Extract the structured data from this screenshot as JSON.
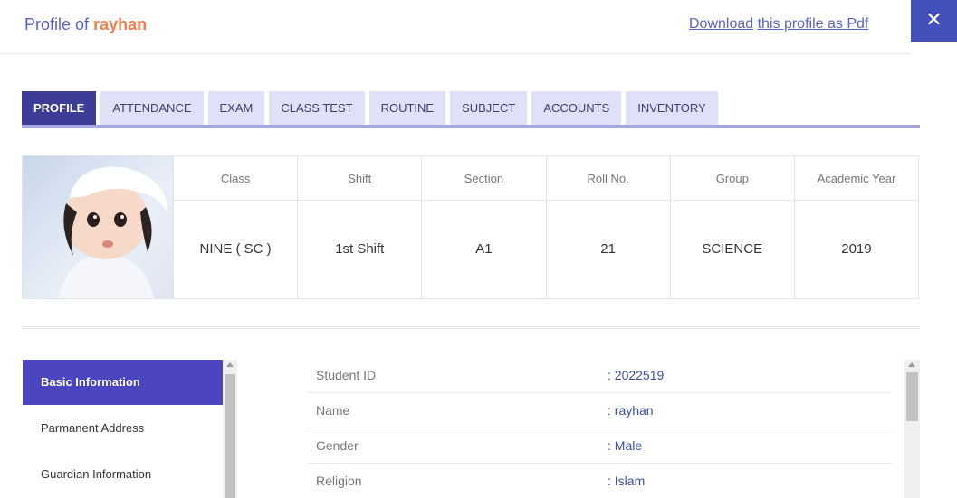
{
  "header": {
    "title_prefix": "Profile of",
    "user_name": "rayhan",
    "download_label": "Download",
    "download_rest": "this profile as Pdf",
    "close_glyph": "✕"
  },
  "tabs": [
    {
      "label": "PROFILE",
      "active": true
    },
    {
      "label": "ATTENDANCE"
    },
    {
      "label": "EXAM"
    },
    {
      "label": "CLASS TEST"
    },
    {
      "label": "ROUTINE"
    },
    {
      "label": "SUBJECT"
    },
    {
      "label": "ACCOUNTS"
    },
    {
      "label": "INVENTORY"
    }
  ],
  "summary": {
    "columns": [
      {
        "head": "Class",
        "value": "NINE ( SC )"
      },
      {
        "head": "Shift",
        "value": "1st Shift"
      },
      {
        "head": "Section",
        "value": "A1"
      },
      {
        "head": "Roll No.",
        "value": "21"
      },
      {
        "head": "Group",
        "value": "SCIENCE"
      },
      {
        "head": "Academic Year",
        "value": "2019"
      }
    ]
  },
  "side_menu": [
    {
      "label": "Basic Information",
      "active": true
    },
    {
      "label": "Parmanent Address"
    },
    {
      "label": "Guardian Information"
    }
  ],
  "info": [
    {
      "key": "Student ID",
      "value": ": 2022519"
    },
    {
      "key": "Name",
      "value": ": rayhan"
    },
    {
      "key": "Gender",
      "value": ": Male"
    },
    {
      "key": "Religion",
      "value": ": Islam"
    }
  ],
  "colors": {
    "accent": "#4350b9",
    "tab_active": "#3d3c96",
    "tab_inactive": "#dfe1f8",
    "side_active": "#4b46bf",
    "username": "#f27e4c"
  }
}
